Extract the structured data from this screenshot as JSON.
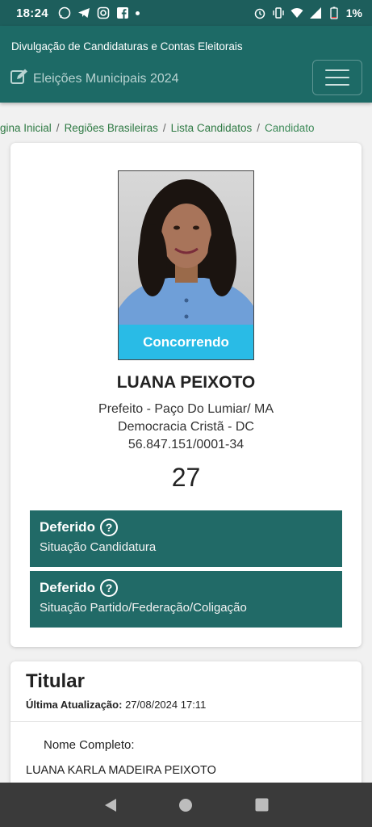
{
  "status_bar": {
    "time": "18:24",
    "battery": "1%",
    "icons": [
      "whatsapp-icon",
      "telegram-icon",
      "instagram-icon",
      "facebook-icon",
      "alarm-icon",
      "vibrate-icon",
      "wifi-icon",
      "signal-icon",
      "battery-icon"
    ]
  },
  "header": {
    "subtitle": "Divulgação de Candidaturas e Contas Eleitorais",
    "brand": "Eleições Municipais 2024",
    "brand_icon": "edit-icon",
    "menu_icon": "hamburger-menu-icon"
  },
  "breadcrumb": {
    "items": [
      "gina Inicial",
      "Regiões Brasileiras",
      "Lista Candidatos"
    ],
    "separator": "/",
    "current": "Candidato"
  },
  "candidate": {
    "badge": "Concorrendo",
    "name": "LUANA PEIXOTO",
    "office": "Prefeito - Paço Do Lumiar/ MA",
    "party": "Democracia Cristã - DC",
    "cnpj": "56.847.151/0001-34",
    "number": "27",
    "status": [
      {
        "title": "Deferido",
        "desc": "Situação Candidatura"
      },
      {
        "title": "Deferido",
        "desc": "Situação Partido/Federação/Coligação"
      }
    ]
  },
  "titular": {
    "title": "Titular",
    "update_label": "Última Atualização:",
    "update_value": "27/08/2024 17:11",
    "full_name_label": "Nome Completo:",
    "full_name_value": "LUANA KARLA MADEIRA PEIXOTO"
  },
  "colors": {
    "header": "#1d6a66",
    "status_box": "#216a67",
    "badge": "#29bbe6",
    "breadcrumb_link": "#2f7a44"
  }
}
